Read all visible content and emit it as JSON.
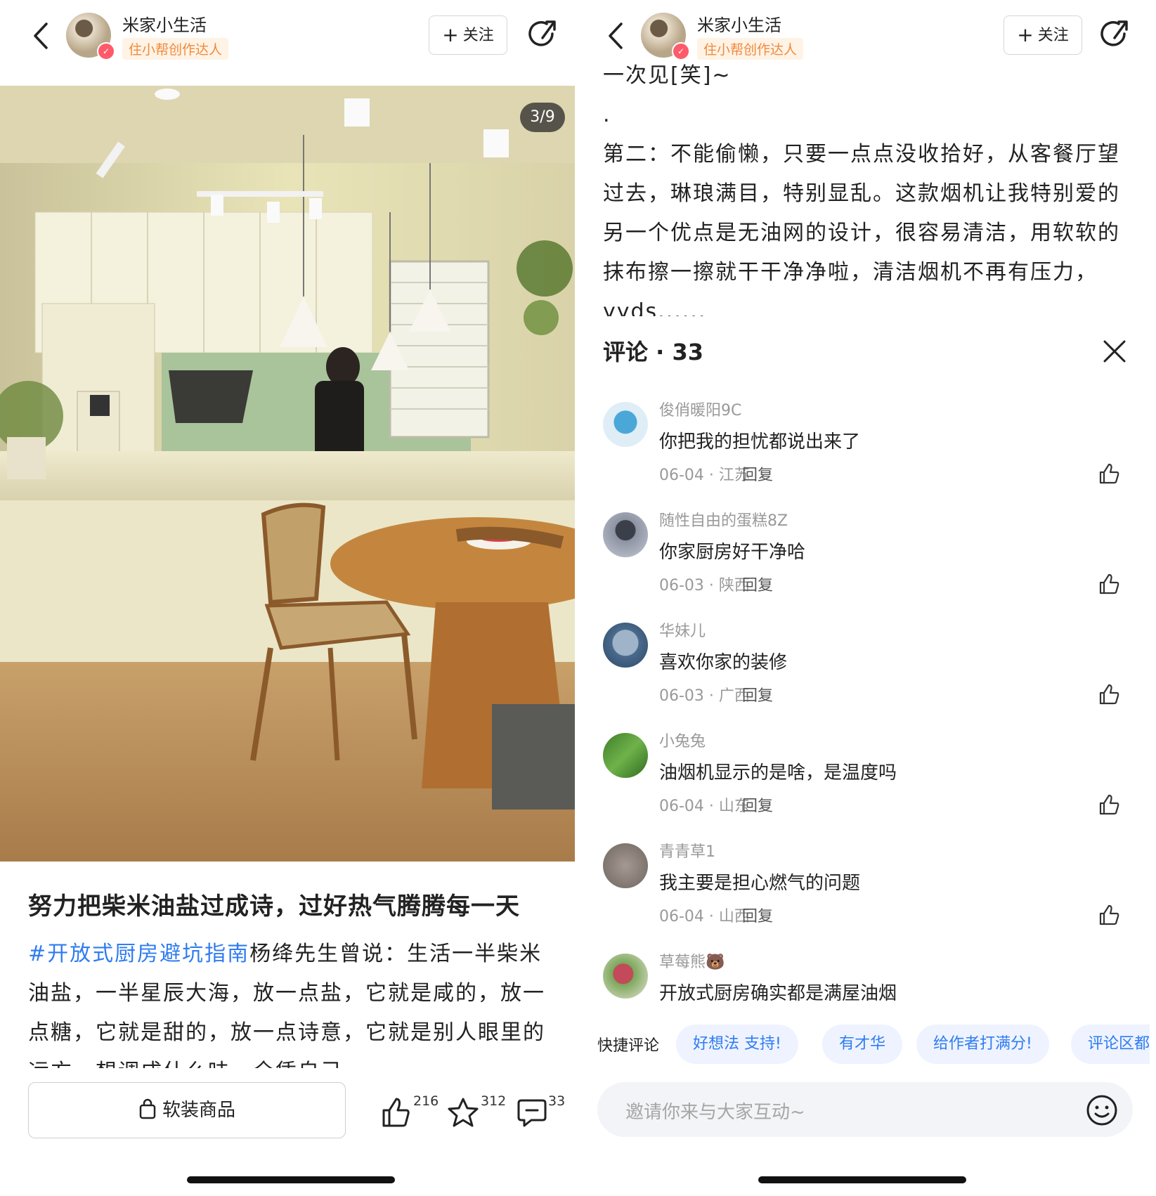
{
  "left": {
    "header": {
      "author_name": "米家小生活",
      "author_tag": "住小帮创作达人",
      "follow_label": "关注"
    },
    "photo": {
      "counter": "3/9"
    },
    "post": {
      "title": "努力把柴米油盐过成诗，过好热气腾腾每一天",
      "hashtag": "#开放式厨房避坑指南",
      "body": "杨绛先生曾说：生活一半柴米油盐，一半星辰大海，放一点盐，它就是咸的，放一点糖，它就是甜的，放一点诗意，它就是别人眼里的远方。想调成什么味，全凭自己。"
    },
    "bottom_bar": {
      "shop_label": "软装商品",
      "like_count": "216",
      "star_count": "312",
      "comment_count": "33"
    }
  },
  "right": {
    "header": {
      "author_name": "米家小生活",
      "author_tag": "住小帮创作达人",
      "follow_label": "关注"
    },
    "description": {
      "line_top": "一次见[笑]~",
      "dot": ".",
      "paragraph": "第二：不能偷懒，只要一点点没收拾好，从客餐厅望过去，琳琅满目，特别显乱。这款烟机让我特别爱的另一个优点是无油网的设计，很容易清洁，用软软的抹布擦一擦就干干净净啦，清洁烟机不再有压力，yyds......"
    },
    "comments_header": {
      "label": "评论",
      "separator": "·",
      "count": "33"
    },
    "comments": [
      {
        "name": "俊俏暖阳9C",
        "text": "你把我的担忧都说出来了",
        "date": "06-04",
        "region": "江苏",
        "reply": "回复"
      },
      {
        "name": "随性自由的蛋糕8Z",
        "text": "你家厨房好干净哈",
        "date": "06-03",
        "region": "陕西",
        "reply": "回复"
      },
      {
        "name": "华妹儿",
        "text": "喜欢你家的装修",
        "date": "06-03",
        "region": "广西",
        "reply": "回复"
      },
      {
        "name": "小兔兔",
        "text": "油烟机显示的是啥，是温度吗",
        "date": "06-04",
        "region": "山东",
        "reply": "回复"
      },
      {
        "name": "青青草1",
        "text": "我主要是担心燃气的问题",
        "date": "06-04",
        "region": "山西",
        "reply": "回复"
      },
      {
        "name": "草莓熊🐻",
        "text": "开放式厨房确实都是满屋油烟",
        "date": "",
        "region": "",
        "reply": ""
      }
    ],
    "quick_comments": {
      "label": "快捷评论",
      "chips": [
        "好想法 支持!",
        "有才华",
        "给作者打满分!",
        "评论区都是"
      ]
    },
    "input": {
      "placeholder": "邀请你来与大家互动~"
    }
  },
  "colors": {
    "accent_blue": "#2f7cf0",
    "tag_orange": "#f08a3c",
    "badge_red": "#ff5a6a"
  },
  "icons": [
    "back-icon",
    "share-icon",
    "plus-icon",
    "bag-icon",
    "thumb-up-icon",
    "star-icon",
    "comment-icon",
    "close-icon",
    "like-icon",
    "emoji-icon"
  ]
}
